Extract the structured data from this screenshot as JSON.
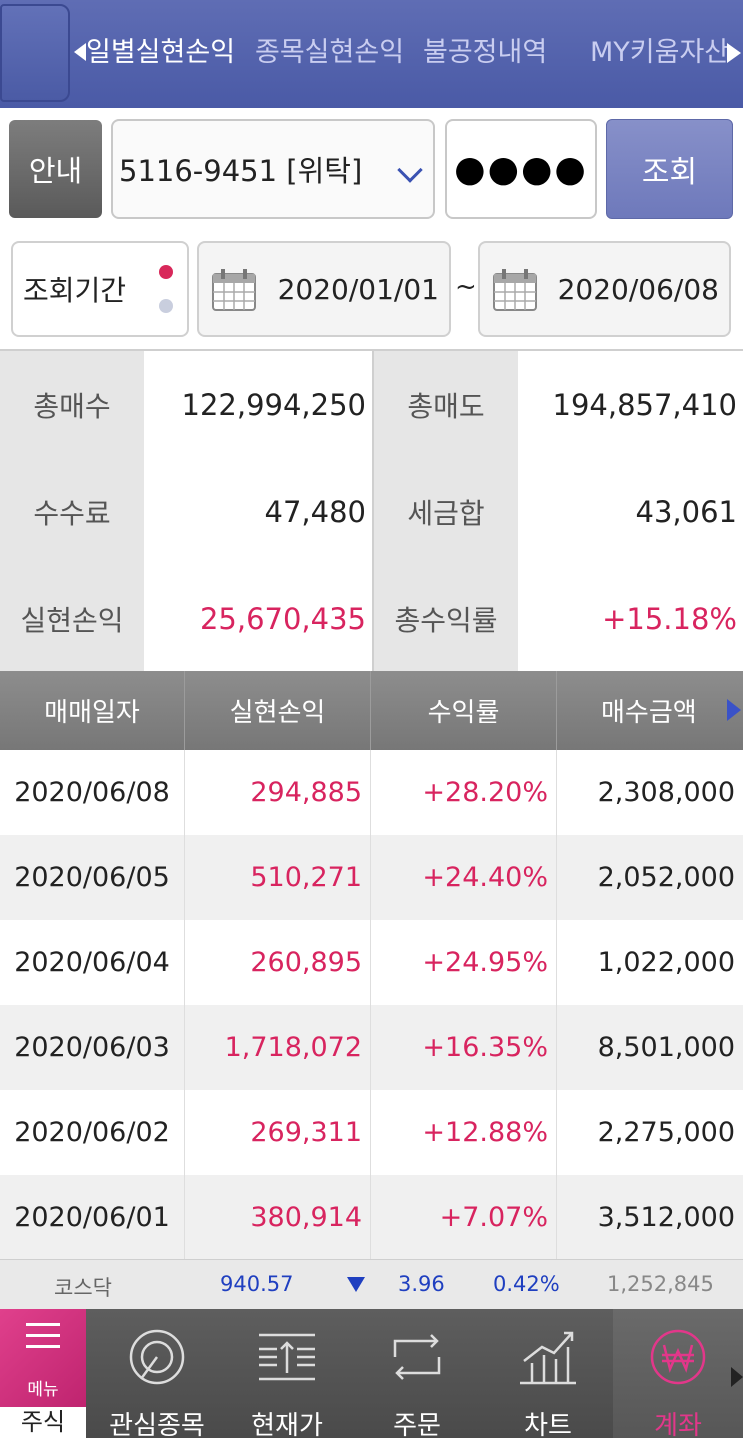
{
  "header": {
    "tabs": [
      {
        "label": "일별실현손익",
        "active": true
      },
      {
        "label": "종목실현손익",
        "active": false
      },
      {
        "label": "불공정내역",
        "active": false
      },
      {
        "label": "MY키움자산",
        "active": false
      }
    ]
  },
  "account": {
    "info_label": "안내",
    "account_value": "5116-9451 [위탁]",
    "password_mask": "●●●●",
    "search_label": "조회"
  },
  "period": {
    "label": "조회기간",
    "start_date": "2020/01/01",
    "separator": "~",
    "end_date": "2020/06/08"
  },
  "summary": {
    "total_buy_label": "총매수",
    "total_buy": "122,994,250",
    "total_sell_label": "총매도",
    "total_sell": "194,857,410",
    "fee_label": "수수료",
    "fee": "47,480",
    "tax_label": "세금합",
    "tax": "43,061",
    "realized_pnl_label": "실현손익",
    "realized_pnl": "25,670,435",
    "total_return_label": "총수익률",
    "total_return": "+15.18%"
  },
  "table": {
    "columns": [
      "매매일자",
      "실현손익",
      "수익률",
      "매수금액"
    ],
    "rows": [
      {
        "date": "2020/06/08",
        "pnl": "294,885",
        "rate": "+28.20%",
        "buy": "2,308,000"
      },
      {
        "date": "2020/06/05",
        "pnl": "510,271",
        "rate": "+24.40%",
        "buy": "2,052,000"
      },
      {
        "date": "2020/06/04",
        "pnl": "260,895",
        "rate": "+24.95%",
        "buy": "1,022,000"
      },
      {
        "date": "2020/06/03",
        "pnl": "1,718,072",
        "rate": "+16.35%",
        "buy": "8,501,000"
      },
      {
        "date": "2020/06/02",
        "pnl": "269,311",
        "rate": "+12.88%",
        "buy": "2,275,000"
      },
      {
        "date": "2020/06/01",
        "pnl": "380,914",
        "rate": "+7.07%",
        "buy": "3,512,000"
      }
    ]
  },
  "ticker": {
    "name": "코스닥",
    "index": "940.57",
    "change": "3.96",
    "change_pct": "0.42%",
    "volume": "1,252,845"
  },
  "bottom_nav": {
    "menu_label": "메뉴",
    "stock_label": "주식",
    "items": [
      {
        "label": "관심종목",
        "icon": "target-icon"
      },
      {
        "label": "현재가",
        "icon": "price-icon"
      },
      {
        "label": "주문",
        "icon": "order-swap-icon"
      },
      {
        "label": "차트",
        "icon": "chart-icon"
      },
      {
        "label": "계좌",
        "icon": "won-icon",
        "active": true
      }
    ]
  },
  "colors": {
    "header": "#4f5fa9",
    "positive": "#d8245f",
    "down": "#1f3fc0",
    "menu": "#d3307e"
  }
}
